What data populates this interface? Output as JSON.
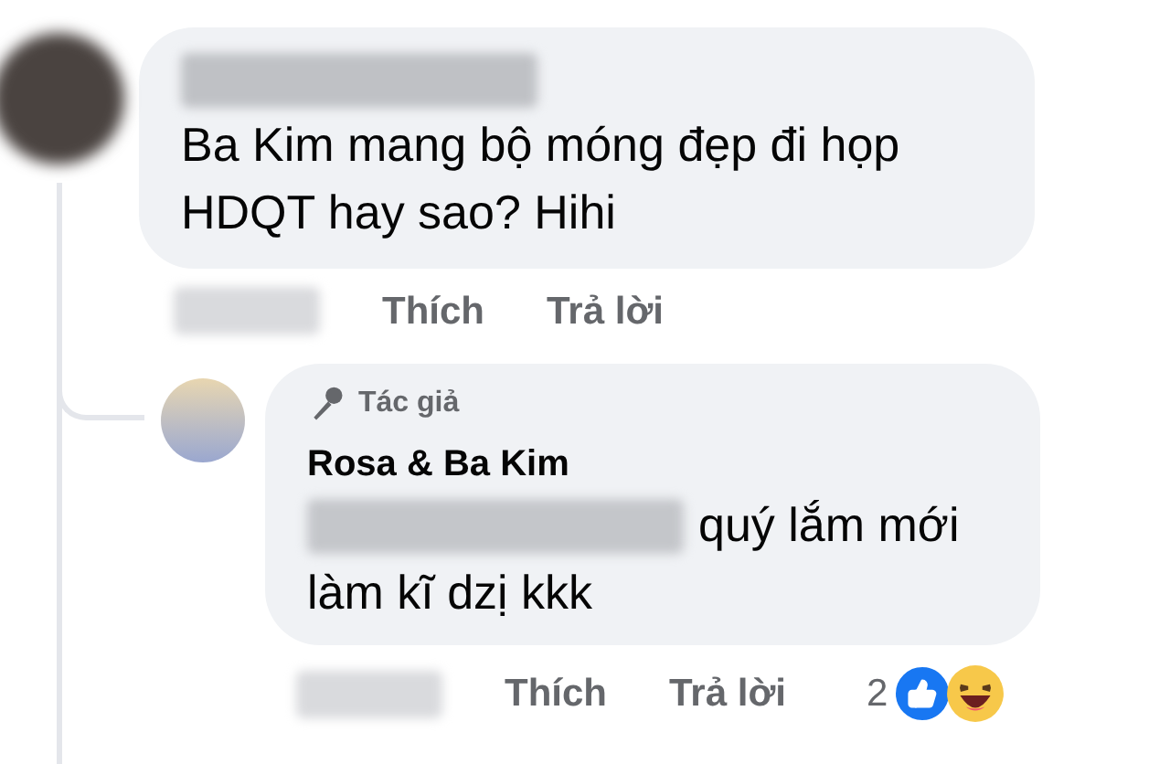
{
  "comment": {
    "text": "Ba Kim mang bộ móng đẹp đi họp HDQT hay sao? Hihi",
    "actions": [
      "Thích",
      "Trả lời"
    ]
  },
  "reply": {
    "badge": "Tác giả",
    "author": "Rosa & Ba Kim",
    "text_lines": [
      "quý lắm mới",
      "làm kĩ dzị kkk"
    ],
    "actions": [
      "Thích",
      "Trả lời"
    ],
    "reaction_count": "2"
  }
}
